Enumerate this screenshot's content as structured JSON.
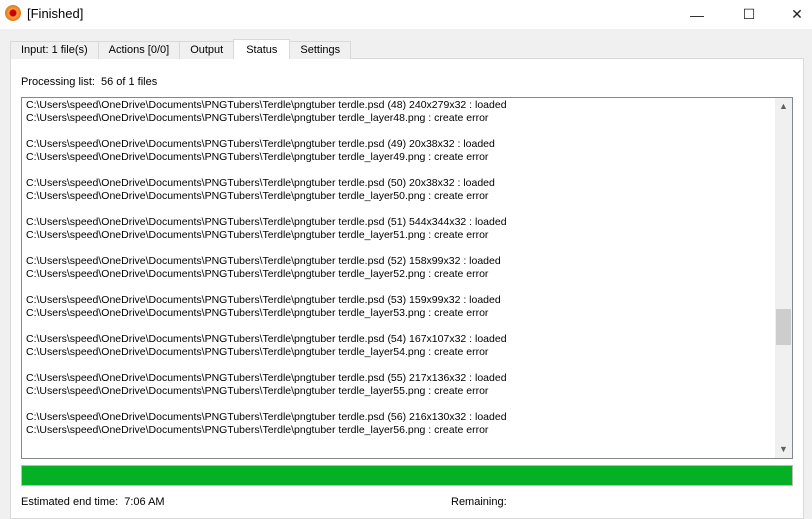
{
  "window": {
    "title": "[Finished]",
    "minimize": "—",
    "maximize": "☐",
    "close": "✕"
  },
  "tabs": [
    "Input: 1 file(s)",
    "Actions [0/0]",
    "Output",
    "Status",
    "Settings"
  ],
  "active_tab": "Status",
  "processing": {
    "label": "Processing list:",
    "value": "56 of 1 files"
  },
  "log": [
    {
      "loaded": "C:\\Users\\speed\\OneDrive\\Documents\\PNGTubers\\Terdle\\pngtuber terdle.psd (48) 240x279x32 : loaded",
      "error": "C:\\Users\\speed\\OneDrive\\Documents\\PNGTubers\\Terdle\\pngtuber terdle_layer48.png : create error"
    },
    {
      "loaded": "C:\\Users\\speed\\OneDrive\\Documents\\PNGTubers\\Terdle\\pngtuber terdle.psd (49) 20x38x32 : loaded",
      "error": "C:\\Users\\speed\\OneDrive\\Documents\\PNGTubers\\Terdle\\pngtuber terdle_layer49.png : create error"
    },
    {
      "loaded": "C:\\Users\\speed\\OneDrive\\Documents\\PNGTubers\\Terdle\\pngtuber terdle.psd (50) 20x38x32 : loaded",
      "error": "C:\\Users\\speed\\OneDrive\\Documents\\PNGTubers\\Terdle\\pngtuber terdle_layer50.png : create error"
    },
    {
      "loaded": "C:\\Users\\speed\\OneDrive\\Documents\\PNGTubers\\Terdle\\pngtuber terdle.psd (51) 544x344x32 : loaded",
      "error": "C:\\Users\\speed\\OneDrive\\Documents\\PNGTubers\\Terdle\\pngtuber terdle_layer51.png : create error"
    },
    {
      "loaded": "C:\\Users\\speed\\OneDrive\\Documents\\PNGTubers\\Terdle\\pngtuber terdle.psd (52) 158x99x32 : loaded",
      "error": "C:\\Users\\speed\\OneDrive\\Documents\\PNGTubers\\Terdle\\pngtuber terdle_layer52.png : create error"
    },
    {
      "loaded": "C:\\Users\\speed\\OneDrive\\Documents\\PNGTubers\\Terdle\\pngtuber terdle.psd (53) 159x99x32 : loaded",
      "error": "C:\\Users\\speed\\OneDrive\\Documents\\PNGTubers\\Terdle\\pngtuber terdle_layer53.png : create error"
    },
    {
      "loaded": "C:\\Users\\speed\\OneDrive\\Documents\\PNGTubers\\Terdle\\pngtuber terdle.psd (54) 167x107x32 : loaded",
      "error": "C:\\Users\\speed\\OneDrive\\Documents\\PNGTubers\\Terdle\\pngtuber terdle_layer54.png : create error"
    },
    {
      "loaded": "C:\\Users\\speed\\OneDrive\\Documents\\PNGTubers\\Terdle\\pngtuber terdle.psd (55) 217x136x32 : loaded",
      "error": "C:\\Users\\speed\\OneDrive\\Documents\\PNGTubers\\Terdle\\pngtuber terdle_layer55.png : create error"
    },
    {
      "loaded": "C:\\Users\\speed\\OneDrive\\Documents\\PNGTubers\\Terdle\\pngtuber terdle.psd (56) 216x130x32 : loaded",
      "error": "C:\\Users\\speed\\OneDrive\\Documents\\PNGTubers\\Terdle\\pngtuber terdle_layer56.png : create error"
    }
  ],
  "progress": {
    "percent": 100,
    "color": "#06b025"
  },
  "footer": {
    "eta_label": "Estimated end time:",
    "eta_value": "7:06 AM",
    "remaining_label": "Remaining:"
  }
}
